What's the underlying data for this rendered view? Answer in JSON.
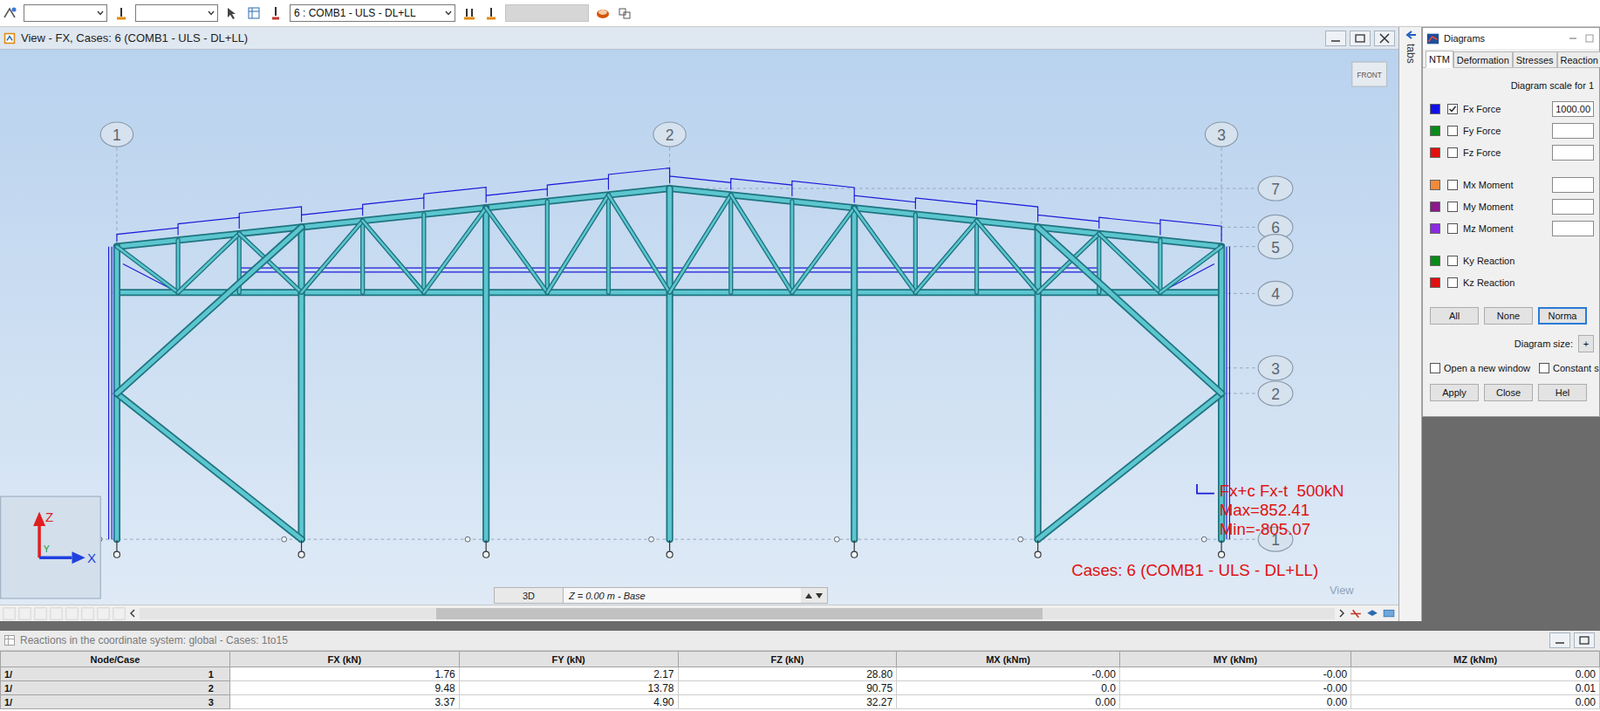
{
  "toolbar": {
    "combos": [
      {
        "value": "",
        "disabled": false
      },
      {
        "value": "",
        "disabled": false
      },
      {
        "value": "6 : COMB1 - ULS - DL+LL",
        "disabled": false
      },
      {
        "value": "",
        "disabled": true
      }
    ]
  },
  "view": {
    "title": "View - FX, Cases: 6 (COMB1 - ULS - DL+LL)",
    "cube_label": "FRONT",
    "grid_axes": [
      {
        "label": "1"
      },
      {
        "label": "2"
      },
      {
        "label": "3"
      }
    ],
    "levels": [
      {
        "label": "7"
      },
      {
        "label": "6"
      },
      {
        "label": "5"
      },
      {
        "label": "4"
      },
      {
        "label": "3"
      },
      {
        "label": "2"
      },
      {
        "label": "1"
      }
    ],
    "legend": {
      "heading": "Fx+c Fx-t  500kN",
      "max": "Max=852.41",
      "min": "Min=-805.07",
      "cases": "Cases: 6 (COMB1 - ULS - DL+LL)"
    },
    "axes": {
      "z": "Z",
      "x": "X",
      "y": "Y"
    },
    "mode_tab": "3D",
    "level_field": "Z = 0.00 m - Base",
    "corner_label": "View"
  },
  "side_tab": {
    "label": "tabs"
  },
  "diagrams": {
    "title": "Diagrams",
    "tabs": [
      {
        "label": "NTM",
        "selected": true
      },
      {
        "label": "Deformation",
        "selected": false
      },
      {
        "label": "Stresses",
        "selected": false
      },
      {
        "label": "Reaction",
        "selected": false
      }
    ],
    "scale_caption": "Diagram scale for 1",
    "groups": [
      {
        "rows": [
          {
            "label": "Fx Force",
            "kind": "value",
            "checked": true,
            "value": "1000.00",
            "color": "#1010e8"
          },
          {
            "label": "Fy Force",
            "kind": "value",
            "checked": false,
            "value": "",
            "color": "#0a8a1a"
          },
          {
            "label": "Fz Force",
            "kind": "value",
            "checked": false,
            "value": "",
            "color": "#e01010"
          }
        ]
      },
      {
        "rows": [
          {
            "label": "Mx Moment",
            "kind": "value",
            "checked": false,
            "value": "",
            "color": "#f08a3c"
          },
          {
            "label": "My Moment",
            "kind": "value",
            "checked": false,
            "value": "",
            "color": "#8a1a8a"
          },
          {
            "label": "Mz Moment",
            "kind": "value",
            "checked": false,
            "value": "",
            "color": "#8a2be2"
          }
        ]
      },
      {
        "rows": [
          {
            "label": "Ky Reaction",
            "kind": "plain",
            "checked": false,
            "color": "#0a8a1a"
          },
          {
            "label": "Kz Reaction",
            "kind": "plain",
            "checked": false,
            "color": "#e01010"
          }
        ]
      }
    ],
    "presets": [
      {
        "label": "All",
        "focused": false
      },
      {
        "label": "None",
        "focused": false
      },
      {
        "label": "Norma",
        "focused": true
      }
    ],
    "size_label": "Diagram size:",
    "size_button": "+",
    "options": [
      {
        "label": "Open a new window",
        "checked": false
      },
      {
        "label": "Constant s",
        "checked": false
      }
    ],
    "actions": [
      "Apply",
      "Close",
      "Hel"
    ]
  },
  "reactions": {
    "title": "Reactions in the coordinate system: global - Cases: 1to15",
    "columns": [
      "Node/Case",
      "FX (kN)",
      "FY (kN)",
      "FZ (kN)",
      "MX (kNm)",
      "MY (kNm)",
      "MZ (kNm)"
    ],
    "rows": [
      {
        "node": "1/",
        "case": "1",
        "values": [
          "1.76",
          "2.17",
          "28.80",
          "-0.00",
          "-0.00",
          "0.00"
        ]
      },
      {
        "node": "1/",
        "case": "2",
        "values": [
          "9.48",
          "13.78",
          "90.75",
          "0.0",
          "-0.00",
          "0.01"
        ]
      },
      {
        "node": "1/",
        "case": "3",
        "values": [
          "3.37",
          "4.90",
          "32.27",
          "0.00",
          "0.00",
          "0.00"
        ]
      }
    ]
  }
}
